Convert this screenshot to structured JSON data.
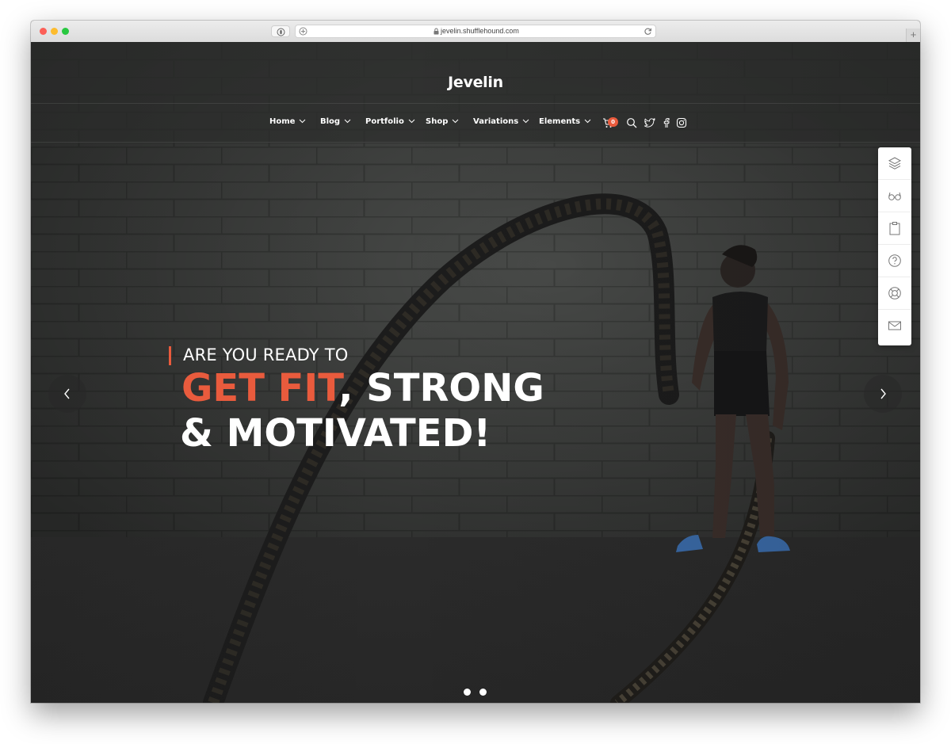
{
  "browser": {
    "url": "jevelin.shufflehound.com",
    "newtab_label": "+"
  },
  "site": {
    "logo": "Jevelin"
  },
  "nav": {
    "items": [
      {
        "label": "Home"
      },
      {
        "label": "Blog"
      },
      {
        "label": "Portfolio"
      },
      {
        "label": "Shop"
      },
      {
        "label": "Variations"
      },
      {
        "label": "Elements"
      }
    ],
    "cart_count": "0",
    "icons": [
      "cart-icon",
      "search-icon",
      "twitter-icon",
      "facebook-icon",
      "instagram-icon"
    ]
  },
  "side_panel": {
    "icons": [
      "layers-icon",
      "glasses-icon",
      "clipboard-icon",
      "help-icon",
      "lifebuoy-icon",
      "mail-icon"
    ]
  },
  "hero": {
    "pre_title": "ARE YOU READY TO",
    "accent": "GET FIT",
    "line1_rest": ", STRONG",
    "line2": "& MOTIVATED!"
  },
  "slider": {
    "total_slides": 2,
    "active_slide": 1
  },
  "colors": {
    "accent": "#e95b3d",
    "background": "#383938",
    "text": "#ffffff"
  }
}
